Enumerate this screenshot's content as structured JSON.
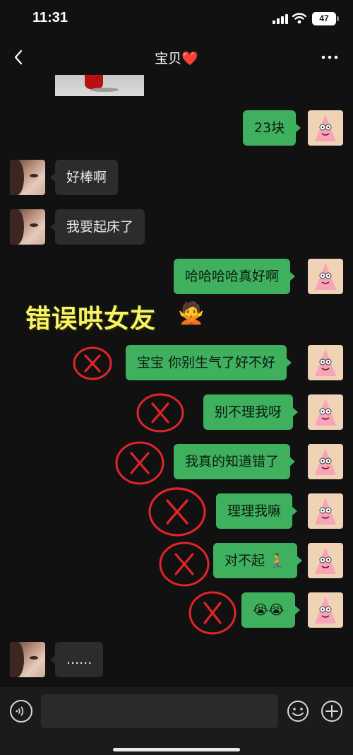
{
  "status_bar": {
    "time": "11:31",
    "battery": "47"
  },
  "header": {
    "title": "宝贝",
    "title_heart": "❤️"
  },
  "overlay": {
    "caption": "错误哄女友",
    "emoji": "🙅"
  },
  "messages": [
    {
      "side": "out",
      "text": "23块"
    },
    {
      "side": "in",
      "text": "好棒啊"
    },
    {
      "side": "in",
      "text": "我要起床了"
    },
    {
      "side": "out",
      "text": "哈哈哈哈真好啊"
    },
    {
      "side": "out",
      "text": "宝宝 你别生气了好不好"
    },
    {
      "side": "out",
      "text": "别不理我呀"
    },
    {
      "side": "out",
      "text": "我真的知道错了"
    },
    {
      "side": "out",
      "text": "理理我嘛"
    },
    {
      "side": "out",
      "text": "对不起 🧎"
    },
    {
      "side": "out",
      "text": "😭😭"
    },
    {
      "side": "in",
      "text": "......"
    }
  ],
  "input": {
    "placeholder": ""
  },
  "icons": {
    "back": "chevron-left-icon",
    "more": "more-dots-icon",
    "voice": "voice-icon",
    "emoji": "emoji-icon",
    "plus": "plus-icon",
    "wrong_mark": "red-x-mark"
  },
  "colors": {
    "outgoing_bubble": "#3fb15e",
    "incoming_bubble": "#2c2c2c",
    "background": "#111111",
    "mark_red": "#e0242a",
    "caption_yellow": "#f7f46a"
  }
}
